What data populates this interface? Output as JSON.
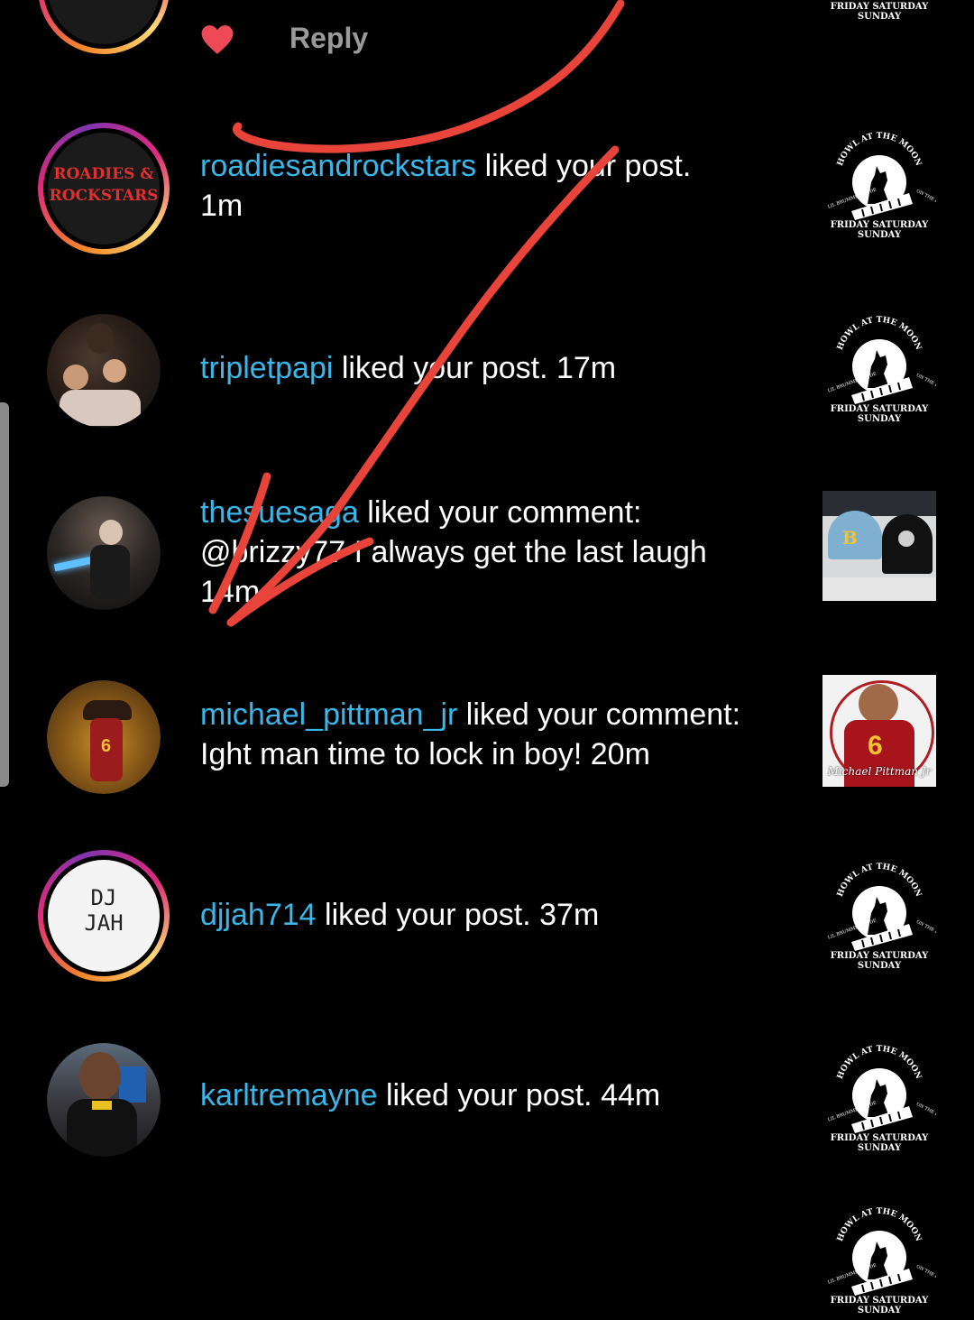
{
  "top_row": {
    "reply_label": "Reply",
    "thumb_caption": "FRIDAY SATURDAY\nSUNDAY"
  },
  "thumbnail_logo": {
    "arc_text": "HOWL AT THE MOON",
    "left_text": "LIL BRUMMER DUDE",
    "right_text": "ON THE DRUMS",
    "bottom_line1": "FRIDAY SATURDAY",
    "bottom_line2": "SUNDAY"
  },
  "notifications": [
    {
      "username": "roadiesandrockstars",
      "action": " liked your post.",
      "line2": "1m",
      "avatar_text_1": "ROADIES &",
      "avatar_text_2": "ROCKSTARS"
    },
    {
      "username": "tripletpapi",
      "action": " liked your post. 17m"
    },
    {
      "username": "thesuesaga",
      "action": " liked your comment:",
      "line2": "@brizzy77 I always get the last laugh",
      "line3": "14m"
    },
    {
      "username": "michael_pittman_jr",
      "action": " liked your comment:",
      "line2": "Ight man time to lock in boy! 20m",
      "thumb_caption": "Michael Pittman Jr"
    },
    {
      "username": "djjah714",
      "action": " liked your post. 37m",
      "avatar_text_1": "DJ",
      "avatar_text_2": "JAH"
    },
    {
      "username": "karltremayne",
      "action": " liked your post. 44m"
    }
  ],
  "colors": {
    "username": "#3ab6e8",
    "heart": "#ed4956",
    "annotation": "#e8443a"
  }
}
